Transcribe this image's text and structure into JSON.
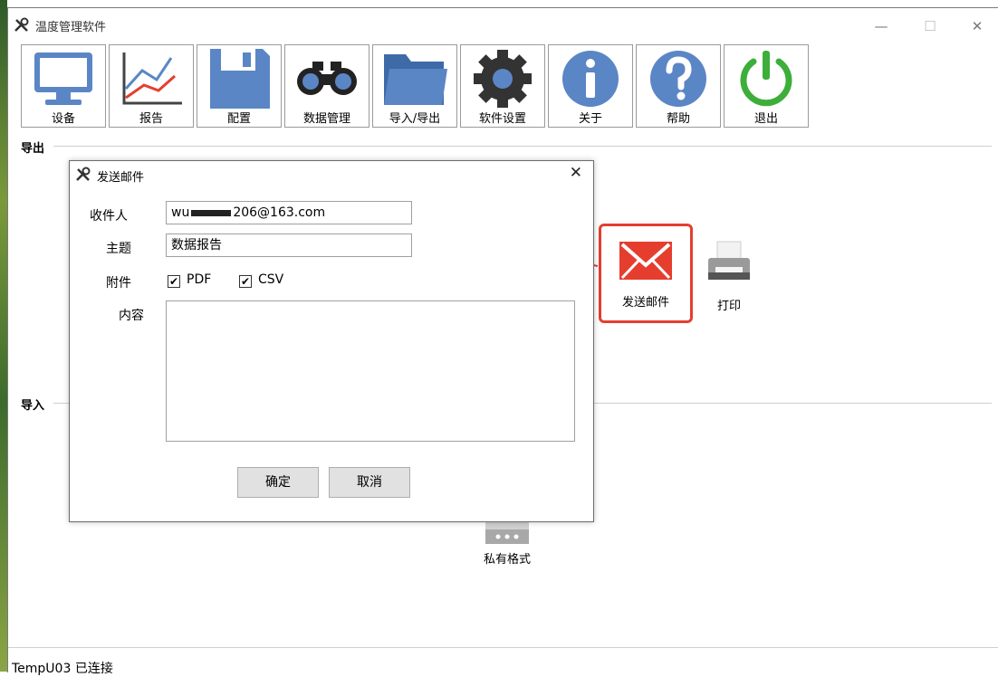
{
  "window": {
    "title": "温度管理软件",
    "controls": {
      "minimize": "—",
      "maximize": "☐",
      "close": "✕"
    }
  },
  "toolbar": {
    "items": [
      {
        "label": "设备",
        "icon": "monitor-icon"
      },
      {
        "label": "报告",
        "icon": "line-chart-icon"
      },
      {
        "label": "配置",
        "icon": "floppy-disk-icon"
      },
      {
        "label": "数据管理",
        "icon": "binoculars-icon"
      },
      {
        "label": "导入/导出",
        "icon": "folder-icon"
      },
      {
        "label": "软件设置",
        "icon": "gear-icon"
      },
      {
        "label": "关于",
        "icon": "info-icon"
      },
      {
        "label": "帮助",
        "icon": "help-icon"
      },
      {
        "label": "退出",
        "icon": "power-icon"
      }
    ]
  },
  "export_group": {
    "title": "导出",
    "send_mail_label": "发送邮件",
    "print_label": "打印"
  },
  "import_group": {
    "title": "导入",
    "private_format_label": "私有格式"
  },
  "dialog": {
    "title": "发送邮件",
    "recipient_label": "收件人",
    "recipient_value": "206@163.com",
    "recipient_prefix": "wu",
    "subject_label": "主题",
    "subject_value": "数据报告",
    "attachment_label": "附件",
    "attachments": [
      {
        "label": "PDF",
        "checked": true
      },
      {
        "label": "CSV",
        "checked": true
      }
    ],
    "content_label": "内容",
    "ok_label": "确定",
    "cancel_label": "取消"
  },
  "status": {
    "text": "TempU03 已连接"
  },
  "colors": {
    "accent_red": "#e53e2f",
    "icon_blue": "#5b86c5",
    "power_green": "#3dae3a"
  }
}
